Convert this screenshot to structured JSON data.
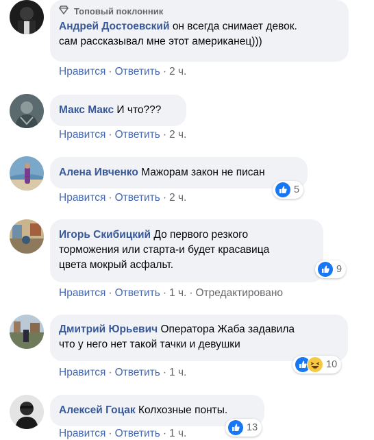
{
  "comments": [
    {
      "badge": "Топовый поклонник",
      "author": "Андрей Достоевский",
      "text_line1": "он всегда снимает девок.",
      "text_line2": "сам рассказывал мне этот американец)))",
      "like": "Нравится",
      "reply": "Ответить",
      "time": "2 ч."
    },
    {
      "author": "Макс Макс",
      "text": "И что???",
      "like": "Нравится",
      "reply": "Ответить",
      "time": "2 ч."
    },
    {
      "author": "Алена Ивченко",
      "text": "Мажорам закон не писан",
      "like": "Нравится",
      "reply": "Ответить",
      "time": "2 ч.",
      "reactions": {
        "count": "5"
      }
    },
    {
      "author": "Игорь Скибицкий",
      "text_line1": "До первого резкого",
      "text_line2": "торможения или старта-и будет красавица",
      "text_line3": "цвета мокрый асфальт.",
      "like": "Нравится",
      "reply": "Ответить",
      "time": "1 ч.",
      "edited": "Отредактировано",
      "reactions": {
        "count": "9"
      }
    },
    {
      "author": "Дмитрий Юрьевич",
      "text_line1": "Оператора Жаба задавила",
      "text_line2": "что у него нет такой тачки и девушки",
      "like": "Нравится",
      "reply": "Ответить",
      "time": "1 ч.",
      "reactions": {
        "count": "10"
      }
    },
    {
      "author": "Алексей Гоцак",
      "text": "Колхозные понты.",
      "like": "Нравится",
      "reply": "Ответить",
      "time": "1 ч.",
      "reactions": {
        "count": "13"
      }
    }
  ],
  "colors": {
    "author": "#385898",
    "link": "#4267b2",
    "meta": "#65676b",
    "bubble": "#f0f2f5",
    "like_blue": "#1877f2"
  },
  "icons": {
    "badge": "diamond-icon",
    "like": "like-reaction-icon",
    "haha": "haha-reaction-icon"
  }
}
